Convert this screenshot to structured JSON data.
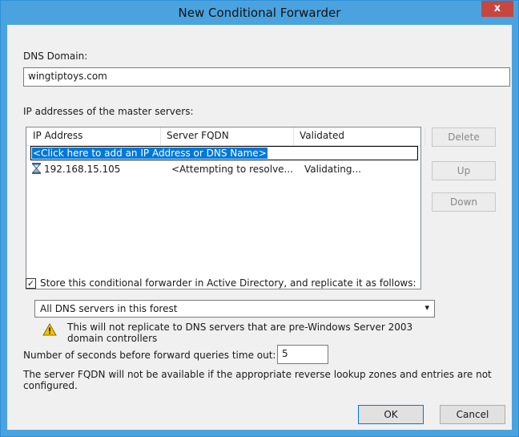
{
  "window": {
    "title": "New Conditional Forwarder",
    "close_glyph": "x"
  },
  "dns_domain": {
    "label": "DNS Domain:",
    "value": "wingtiptoys.com"
  },
  "master_servers": {
    "label": "IP addresses of the master servers:",
    "columns": [
      "IP Address",
      "Server FQDN",
      "Validated"
    ],
    "add_row_text": "<Click here to add an IP Address or DNS Name>",
    "rows": [
      {
        "icon": "hourglass-icon",
        "ip": "192.168.15.105",
        "fqdn": "<Attempting to resolve...",
        "validated": "Validating..."
      }
    ]
  },
  "side_buttons": {
    "delete": "Delete",
    "up": "Up",
    "down": "Down"
  },
  "store_ad": {
    "checked": true,
    "label": "Store this conditional forwarder in Active Directory, and replicate it as follows:"
  },
  "replication": {
    "selected": "All DNS servers in this forest"
  },
  "warning": {
    "line1": "This will not replicate to DNS servers that are pre-Windows Server 2003",
    "line2": "domain controllers"
  },
  "timeout": {
    "label": "Number of seconds before forward queries time out:",
    "value": "5"
  },
  "note": {
    "line1": "The server FQDN will not be available if the appropriate reverse lookup zones and entries are not",
    "line2": "configured."
  },
  "footer": {
    "ok": "OK",
    "cancel": "Cancel"
  },
  "colors": {
    "titlebar": "#4aa3df",
    "selection": "#0078d7",
    "close": "#c7463f",
    "warning": "#f2c200"
  }
}
